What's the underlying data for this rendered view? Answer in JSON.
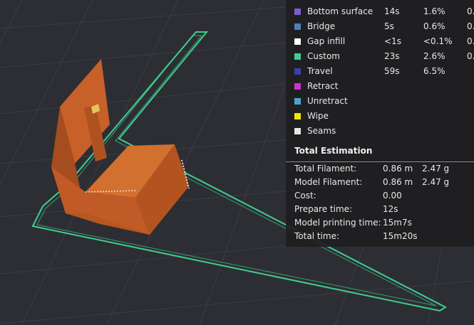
{
  "legend": {
    "items": [
      {
        "name": "Bottom surface",
        "time": "14s",
        "percent": "1.6%",
        "extra": "0.",
        "color": "#7c5cc8"
      },
      {
        "name": "Bridge",
        "time": "5s",
        "percent": "0.6%",
        "extra": "0.",
        "color": "#4a7fc4"
      },
      {
        "name": "Gap infill",
        "time": "<1s",
        "percent": "<0.1%",
        "extra": "0.",
        "color": "#ffffff"
      },
      {
        "name": "Custom",
        "time": "23s",
        "percent": "2.6%",
        "extra": "0.",
        "color": "#3ecf8e"
      },
      {
        "name": "Travel",
        "time": "59s",
        "percent": "6.5%",
        "extra": "",
        "color": "#3a3fa8"
      },
      {
        "name": "Retract",
        "time": "",
        "percent": "",
        "extra": "",
        "color": "#d22fd2"
      },
      {
        "name": "Unretract",
        "time": "",
        "percent": "",
        "extra": "",
        "color": "#4fa3c8"
      },
      {
        "name": "Wipe",
        "time": "",
        "percent": "",
        "extra": "",
        "color": "#f2e600"
      },
      {
        "name": "Seams",
        "time": "",
        "percent": "",
        "extra": "",
        "color": "#e8e8e8"
      }
    ]
  },
  "estimation": {
    "title": "Total Estimation",
    "rows": [
      {
        "label": "Total Filament:",
        "value": "0.86 m",
        "value2": "2.47 g"
      },
      {
        "label": "Model Filament:",
        "value": "0.86 m",
        "value2": "2.47 g"
      },
      {
        "label": "Cost:",
        "value": "0.00",
        "value2": ""
      },
      {
        "label": "Prepare time:",
        "value": "12s",
        "value2": ""
      },
      {
        "label": "Model printing time:",
        "value": "15m7s",
        "value2": ""
      },
      {
        "label": "Total time:",
        "value": "15m20s",
        "value2": ""
      }
    ]
  },
  "colors": {
    "background": "#2d2e33",
    "grid": "#3c3d42",
    "model": "#c8602a",
    "travel_outline": "#3ecf8e"
  }
}
